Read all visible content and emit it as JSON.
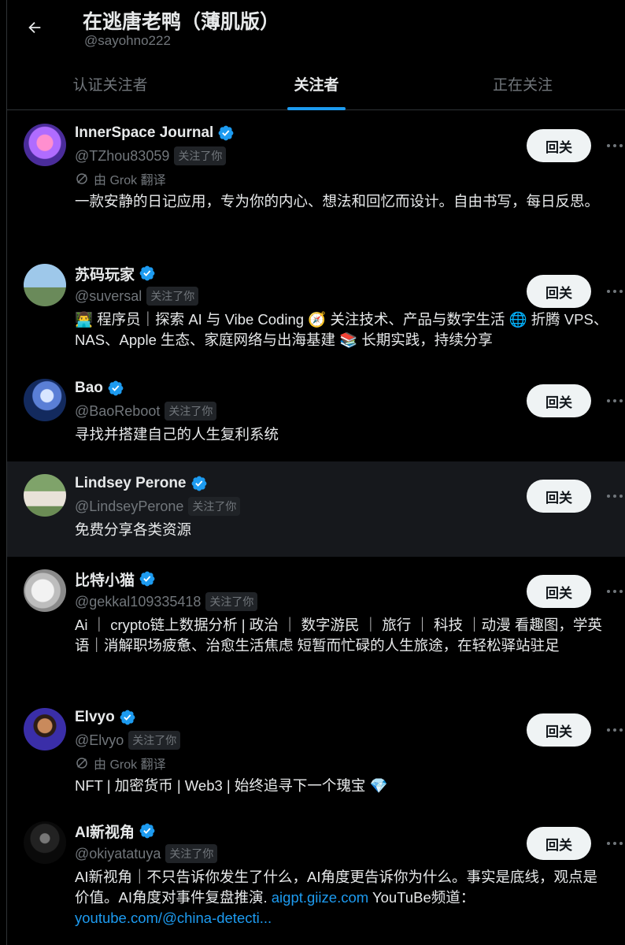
{
  "header": {
    "title": "在逃唐老鸭（薄肌版）",
    "handle": "@sayohno222"
  },
  "tabs": [
    {
      "label": "认证关注者",
      "active": false
    },
    {
      "label": "关注者",
      "active": true
    },
    {
      "label": "正在关注",
      "active": false
    }
  ],
  "labels": {
    "follows_you": "关注了你",
    "follow_back": "回关",
    "translated_by": "由 Grok 翻译"
  },
  "users": [
    {
      "name": "InnerSpace Journal",
      "handle": "@TZhou83059",
      "translated": true,
      "bio_parts": [
        {
          "text": "一款安静的日记应用，专为你的内心、想法和回忆而设计。自由书写，每日反思。"
        }
      ]
    },
    {
      "name": "苏码玩家",
      "handle": "@suversal",
      "translated": false,
      "bio_parts": [
        {
          "text": "👨‍💻 程序员｜探索 AI 与 Vibe Coding 🧭 关注技术、产品与数字生活 🌐 折腾 VPS、NAS、Apple 生态、家庭网络与出海基建 📚 长期实践，持续分享"
        }
      ]
    },
    {
      "name": "Bao",
      "handle": "@BaoReboot",
      "translated": false,
      "bio_parts": [
        {
          "text": "寻找并搭建自己的人生复利系统"
        }
      ]
    },
    {
      "name": "Lindsey Perone",
      "handle": "@LindseyPerone",
      "translated": false,
      "highlighted": true,
      "bio_parts": [
        {
          "text": "免费分享各类资源"
        }
      ]
    },
    {
      "name": "比特小猫",
      "handle": "@gekkal109335418",
      "translated": false,
      "bio_parts": [
        {
          "text": "Ai ｜ crypto链上数据分析 | 政治 ｜ 数字游民 ｜ 旅行 ｜ 科技 ｜动漫 看趣图，学英语｜消解职场疲惫、治愈生活焦虑 短暂而忙碌的人生旅途，在轻松驿站驻足"
        }
      ]
    },
    {
      "name": "Elvyo",
      "handle": "@Elvyo",
      "translated": true,
      "bio_parts": [
        {
          "text": "NFT | 加密货币 | Web3 | 始终追寻下一个瑰宝 💎"
        }
      ]
    },
    {
      "name": "AI新视角",
      "handle": "@okiyatatuya",
      "translated": false,
      "bio_parts": [
        {
          "text": "AI新视角｜不只告诉你发生了什么，AI角度更告诉你为什么。事实是底线，观点是价值。AI角度对事件复盘推演. "
        },
        {
          "text": "aigpt.giize.com",
          "link": true
        },
        {
          "text": " YouTuBe频道："
        },
        {
          "text": "youtube.com/@china-detecti...",
          "link": true
        }
      ]
    }
  ],
  "colors": {
    "accent": "#1d9bf0",
    "background": "#000000",
    "text": "#e7e9ea",
    "muted": "#71767b"
  }
}
